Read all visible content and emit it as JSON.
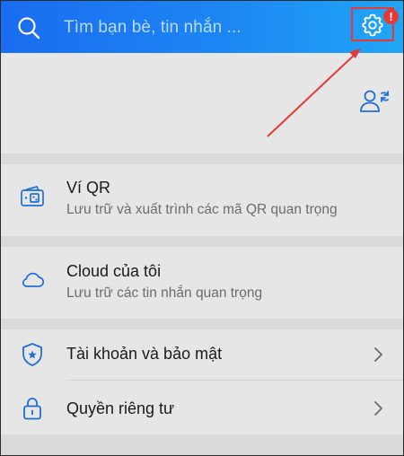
{
  "search": {
    "placeholder": "Tìm bạn bè, tin nhắn ...",
    "icon": "search-icon"
  },
  "settings": {
    "icon": "gear-icon",
    "badge": "!"
  },
  "colors": {
    "header_start": "#1a6cf0",
    "header_end": "#1fa6f6",
    "accent_icon": "#1e6fd9",
    "highlight": "#e53935"
  },
  "items": [
    {
      "title": "Ví QR",
      "subtitle": "Lưu trữ và xuất trình các mã QR quan trọng",
      "icon": "qr-wallet-icon"
    },
    {
      "title": "Cloud của tôi",
      "subtitle": "Lưu trữ các tin nhắn quan trọng",
      "icon": "cloud-icon"
    },
    {
      "title": "Tài khoản và bảo mật",
      "icon": "shield-icon"
    },
    {
      "title": "Quyền riêng tư",
      "icon": "lock-icon"
    }
  ]
}
